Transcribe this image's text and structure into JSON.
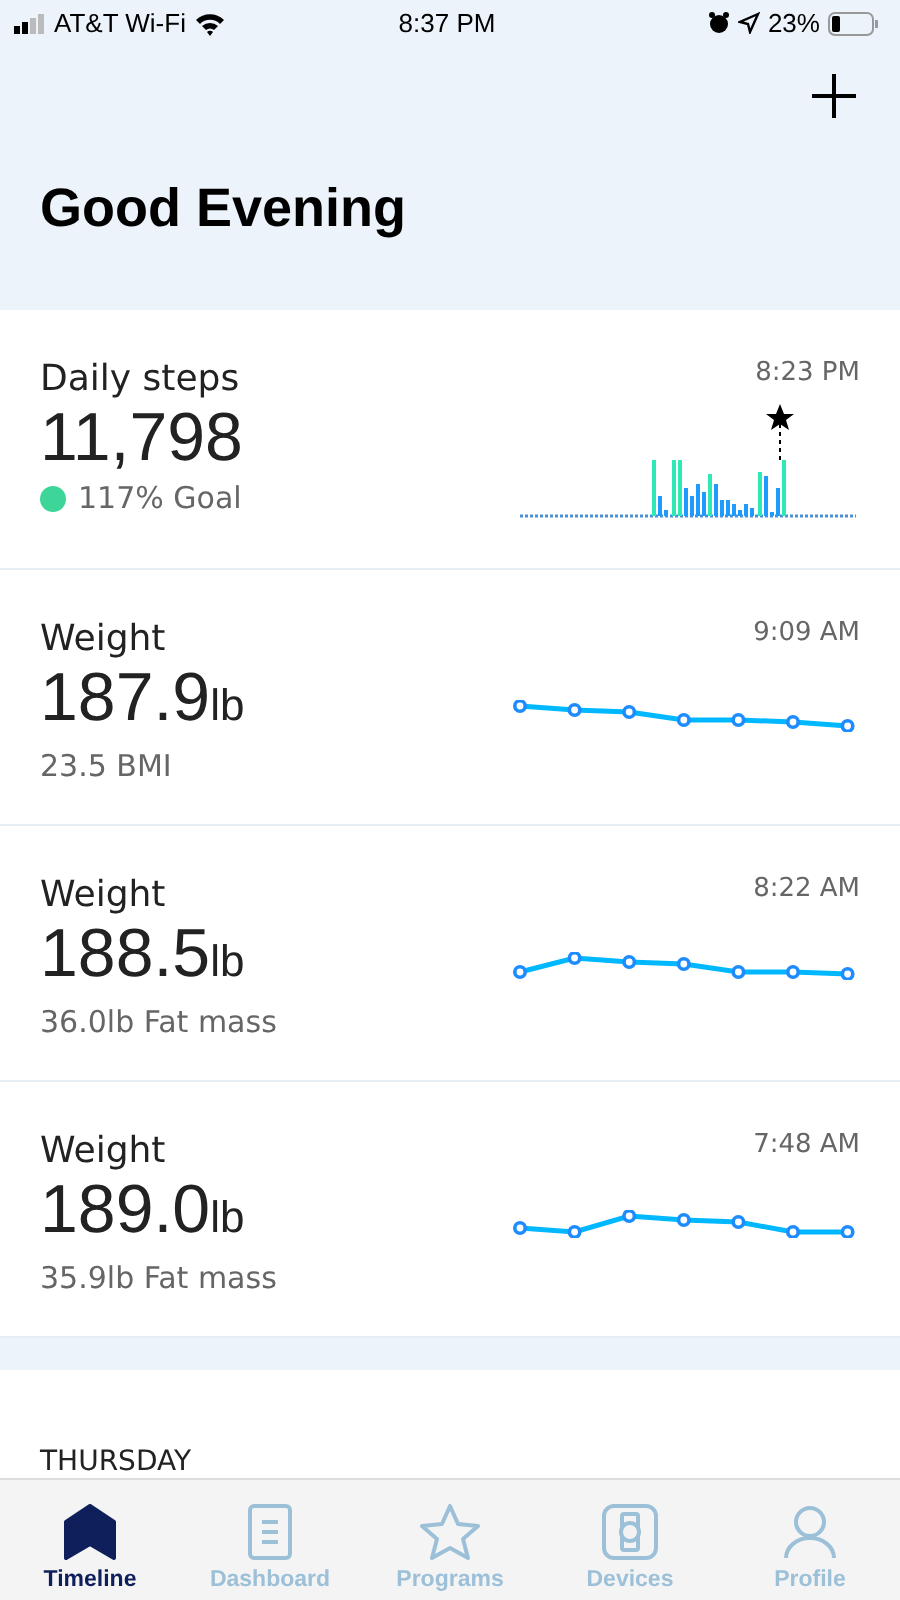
{
  "status_bar": {
    "carrier": "AT&T Wi-Fi",
    "time": "8:37 PM",
    "battery": "23%"
  },
  "header": {
    "title": "Good Evening"
  },
  "cards": [
    {
      "kind": "steps",
      "title": "Daily steps",
      "time": "8:23 PM",
      "value": "11,798",
      "detail": "117% Goal",
      "color": "#3ed598"
    },
    {
      "kind": "weight",
      "title": "Weight",
      "time": "9:09 AM",
      "value": "187.9",
      "unit": "lb",
      "detail": "23.5 BMI"
    },
    {
      "kind": "weight",
      "title": "Weight",
      "time": "8:22 AM",
      "value": "188.5",
      "unit": "lb",
      "detail": "36.0lb Fat mass"
    },
    {
      "kind": "weight",
      "title": "Weight",
      "time": "7:48 AM",
      "value": "189.0",
      "unit": "lb",
      "detail": "35.9lb Fat mass"
    }
  ],
  "day_heading": "THURSDAY",
  "tabs": [
    {
      "label": "Timeline",
      "selected": true
    },
    {
      "label": "Dashboard",
      "selected": false
    },
    {
      "label": "Programs",
      "selected": false
    },
    {
      "label": "Devices",
      "selected": false
    },
    {
      "label": "Profile",
      "selected": false
    }
  ]
}
